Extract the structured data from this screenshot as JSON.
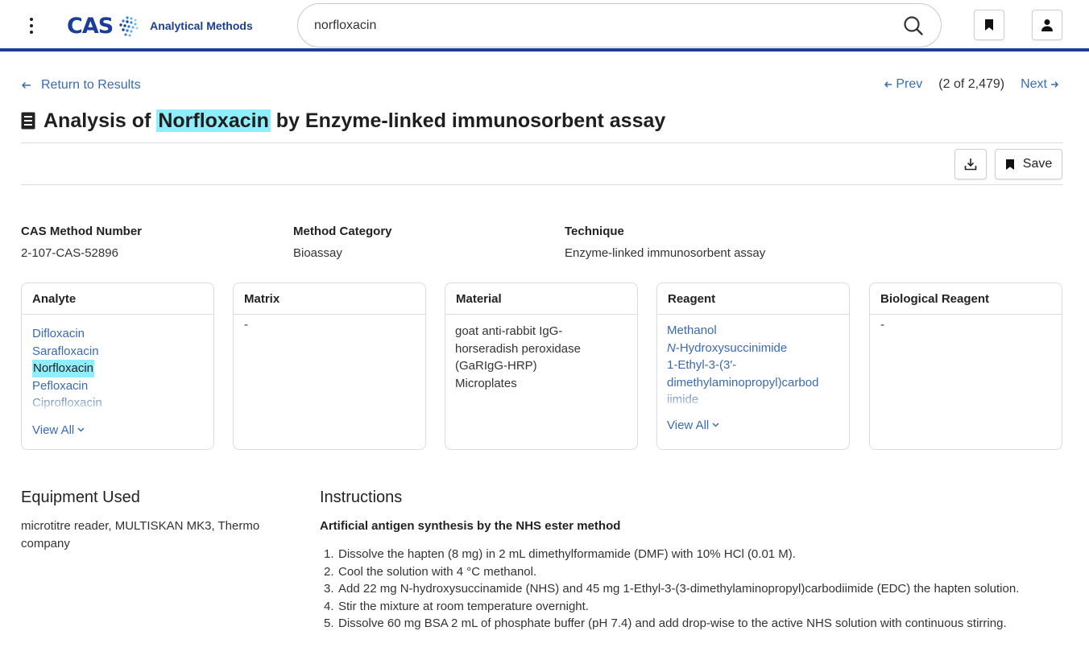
{
  "header": {
    "brand": "CAS",
    "product": "Analytical Methods",
    "search_value": "norfloxacin",
    "icons": {
      "menu": "kebab-menu-icon",
      "search": "search-icon",
      "bookmark": "bookmark-icon",
      "user": "user-icon"
    },
    "accent_color": "#1b3f99"
  },
  "nav": {
    "return_label": "Return to Results",
    "prev_label": "Prev",
    "position": "(2 of 2,479)",
    "next_label": "Next"
  },
  "title": {
    "prefix": "Analysis of ",
    "highlight": "Norfloxacin",
    "suffix": " by Enzyme-linked immunosorbent assay",
    "highlight_color": "#8eeefc"
  },
  "toolbar": {
    "save_label": "Save"
  },
  "meta": [
    {
      "label": "CAS Method Number",
      "value": "2-107-CAS-52896"
    },
    {
      "label": "Method Category",
      "value": "Bioassay"
    },
    {
      "label": "Technique",
      "value": "Enzyme-linked immunosorbent assay"
    }
  ],
  "cards": {
    "analyte": {
      "title": "Analyte",
      "items": [
        "Difloxacin",
        "Sarafloxacin",
        "Norfloxacin",
        "Pefloxacin",
        "Ciprofloxacin"
      ],
      "view_all": "View All"
    },
    "matrix": {
      "title": "Matrix",
      "value": "-"
    },
    "material": {
      "title": "Material",
      "lines": [
        "goat anti-rabbit IgG-",
        "horseradish peroxidase",
        "(GaRIgG-HRP)",
        "Microplates"
      ]
    },
    "reagent": {
      "title": "Reagent",
      "items": [
        "Methanol",
        "-Hydroxysuccinimide",
        "1-Ethyl-3-(3′-",
        "dimethylaminopropyl)carbod",
        "iimide"
      ],
      "italic_prefix": "N",
      "view_all": "View All"
    },
    "biological_reagent": {
      "title": "Biological Reagent",
      "value": "-"
    }
  },
  "equipment": {
    "title": "Equipment Used",
    "lines": [
      "microtitre reader, MULTISKAN MK3, Thermo",
      "company"
    ]
  },
  "instructions": {
    "title": "Instructions",
    "subtitle": "Artificial antigen synthesis by the NHS ester method",
    "steps": [
      {
        "num": "1.",
        "text": "Dissolve the hapten (8 mg) in 2 mL dimethylformamide (DMF) with 10% HCl (0.01 M)."
      },
      {
        "num": "2.",
        "text": "Cool the solution with 4 °C methanol."
      },
      {
        "num": "3.",
        "text": "Add 22 mg N-hydroxysuccinamide (NHS) and 45 mg 1-Ethyl-3-(3-dimethylaminopropyl)carbodiimide (EDC) the hapten solution."
      },
      {
        "num": "4.",
        "text": "Stir the mixture at room temperature overnight."
      },
      {
        "num": "5.",
        "text": "Dissolve 60 mg BSA 2 mL of phosphate buffer (pH 7.4) and add drop-wise to the active NHS solution with continuous stirring."
      }
    ]
  }
}
